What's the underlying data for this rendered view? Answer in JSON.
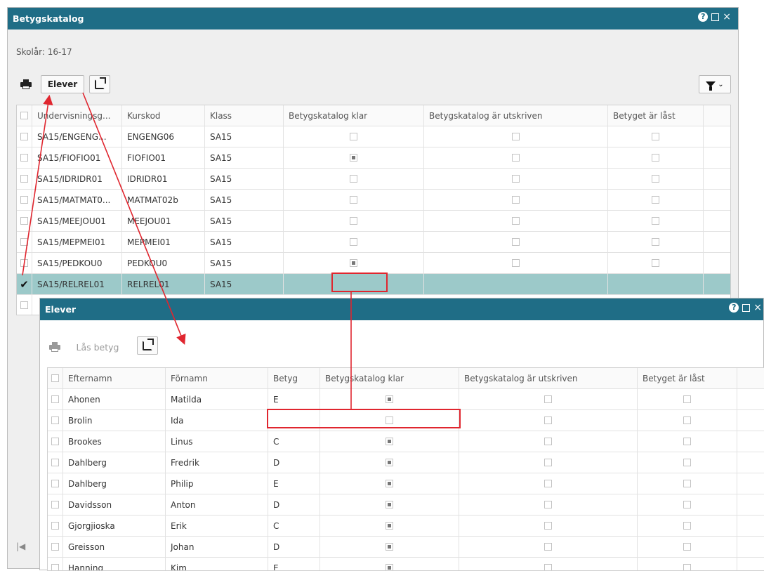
{
  "main_window": {
    "title": "Betygskatalog",
    "school_year_label": "Skolår: 16-17",
    "toolbar": {
      "elever_label": "Elever"
    },
    "columns": [
      "Undervisningsg...",
      "Kurskod",
      "Klass",
      "Betygskatalog klar",
      "Betygskatalog är utskriven",
      "Betyget är låst"
    ],
    "rows": [
      {
        "group": "SA15/ENGENG...",
        "course": "ENGENG06",
        "class": "SA15",
        "klar": false,
        "utskriven": false,
        "last": false,
        "selected": false
      },
      {
        "group": "SA15/FIOFIO01",
        "course": "FIOFIO01",
        "class": "SA15",
        "klar": true,
        "utskriven": false,
        "last": false,
        "selected": false
      },
      {
        "group": "SA15/IDRIDR01",
        "course": "IDRIDR01",
        "class": "SA15",
        "klar": false,
        "utskriven": false,
        "last": false,
        "selected": false
      },
      {
        "group": "SA15/MATMAT0...",
        "course": "MATMAT02b",
        "class": "SA15",
        "klar": false,
        "utskriven": false,
        "last": false,
        "selected": false
      },
      {
        "group": "SA15/MEEJOU01",
        "course": "MEEJOU01",
        "class": "SA15",
        "klar": false,
        "utskriven": false,
        "last": false,
        "selected": false
      },
      {
        "group": "SA15/MEPMEI01",
        "course": "MEPMEI01",
        "class": "SA15",
        "klar": false,
        "utskriven": false,
        "last": false,
        "selected": false
      },
      {
        "group": "SA15/PEDKOU0",
        "course": "PEDKOU0",
        "class": "SA15",
        "klar": true,
        "utskriven": false,
        "last": false,
        "selected": false
      },
      {
        "group": "SA15/RELREL01",
        "course": "RELREL01",
        "class": "SA15",
        "klar": null,
        "utskriven": null,
        "last": null,
        "selected": true
      }
    ]
  },
  "elever_window": {
    "title": "Elever",
    "toolbar": {
      "las_betyg_label": "Lås betyg"
    },
    "columns": [
      "Efternamn",
      "Förnamn",
      "Betyg",
      "Betygskatalog klar",
      "Betygskatalog är utskriven",
      "Betyget är låst"
    ],
    "rows": [
      {
        "last_name": "Ahonen",
        "first_name": "Matilda",
        "grade": "E",
        "klar": true
      },
      {
        "last_name": "Brolin",
        "first_name": "Ida",
        "grade": "",
        "klar": false
      },
      {
        "last_name": "Brookes",
        "first_name": "Linus",
        "grade": "C",
        "klar": true
      },
      {
        "last_name": "Dahlberg",
        "first_name": "Fredrik",
        "grade": "D",
        "klar": true
      },
      {
        "last_name": "Dahlberg",
        "first_name": "Philip",
        "grade": "E",
        "klar": true
      },
      {
        "last_name": "Davidsson",
        "first_name": "Anton",
        "grade": "D",
        "klar": true
      },
      {
        "last_name": "Gjorgjioska",
        "first_name": "Erik",
        "grade": "C",
        "klar": true
      },
      {
        "last_name": "Greisson",
        "first_name": "Johan",
        "grade": "D",
        "klar": true
      },
      {
        "last_name": "Hanning",
        "first_name": "Kim",
        "grade": "E",
        "klar": true
      }
    ]
  },
  "colors": {
    "titlebar": "#1f6d86",
    "selected_row": "#9cc9c9",
    "annotation": "#e0262f"
  },
  "icons": [
    "help-icon",
    "maximize-icon",
    "close-icon",
    "printer-icon",
    "export-icon",
    "filter-icon",
    "chevron-down-icon",
    "checkmark-icon",
    "first-page-icon"
  ]
}
